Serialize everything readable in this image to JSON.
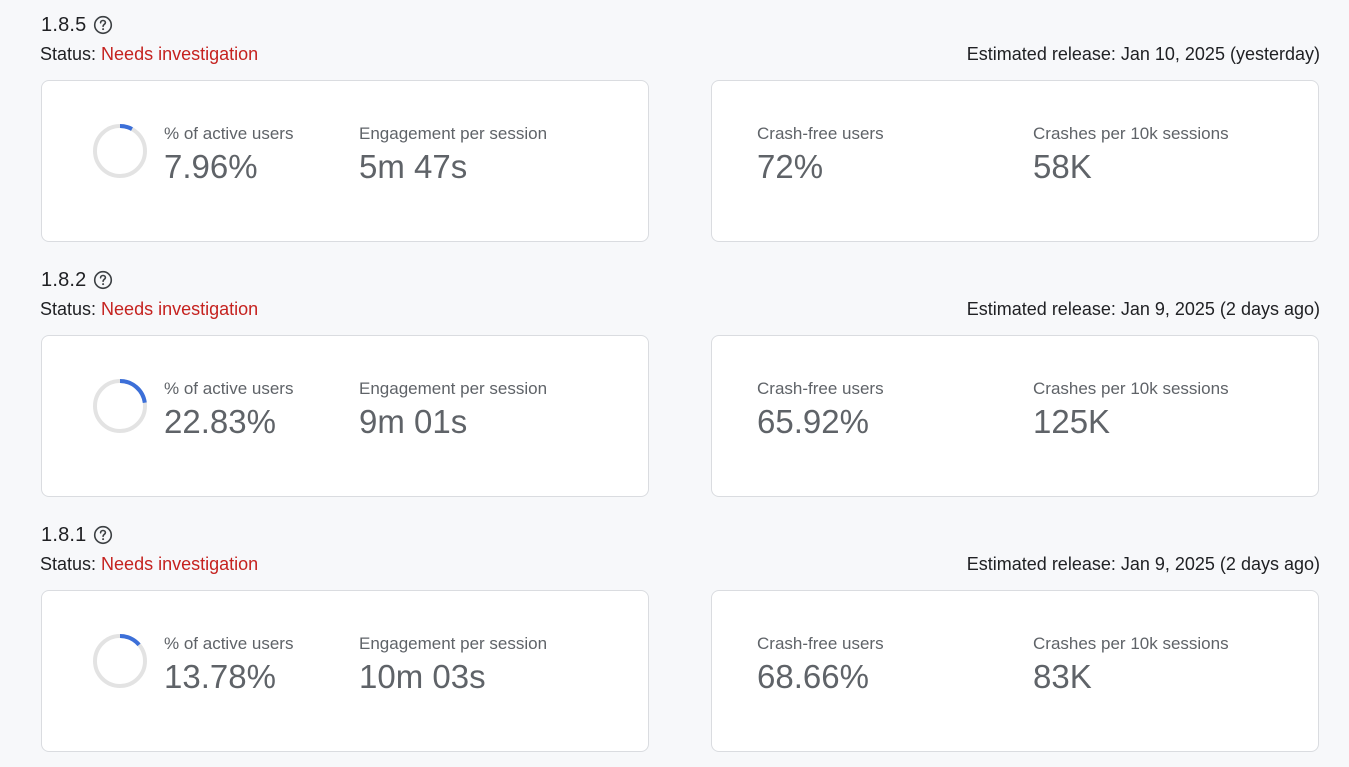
{
  "status_prefix": "Status:",
  "colors": {
    "status_alert": "#c5221f",
    "donut_fill": "#3c6fd8",
    "donut_track": "#e3e3e3"
  },
  "releases": [
    {
      "version": "1.8.5",
      "status": "Needs investigation",
      "estimated_release": "Estimated release: Jan 10, 2025 (yesterday)",
      "active_users_label": "% of active users",
      "active_users_value": "7.96%",
      "active_users_fraction": 0.0796,
      "engagement_label": "Engagement per session",
      "engagement_value": "5m 47s",
      "crash_free_label": "Crash-free users",
      "crash_free_value": "72%",
      "crashes_label": "Crashes per 10k sessions",
      "crashes_value": "58K"
    },
    {
      "version": "1.8.2",
      "status": "Needs investigation",
      "estimated_release": "Estimated release: Jan 9, 2025 (2 days ago)",
      "active_users_label": "% of active users",
      "active_users_value": "22.83%",
      "active_users_fraction": 0.2283,
      "engagement_label": "Engagement per session",
      "engagement_value": "9m 01s",
      "crash_free_label": "Crash-free users",
      "crash_free_value": "65.92%",
      "crashes_label": "Crashes per 10k sessions",
      "crashes_value": "125K"
    },
    {
      "version": "1.8.1",
      "status": "Needs investigation",
      "estimated_release": "Estimated release: Jan 9, 2025 (2 days ago)",
      "active_users_label": "% of active users",
      "active_users_value": "13.78%",
      "active_users_fraction": 0.1378,
      "engagement_label": "Engagement per session",
      "engagement_value": "10m 03s",
      "crash_free_label": "Crash-free users",
      "crash_free_value": "68.66%",
      "crashes_label": "Crashes per 10k sessions",
      "crashes_value": "83K"
    }
  ]
}
